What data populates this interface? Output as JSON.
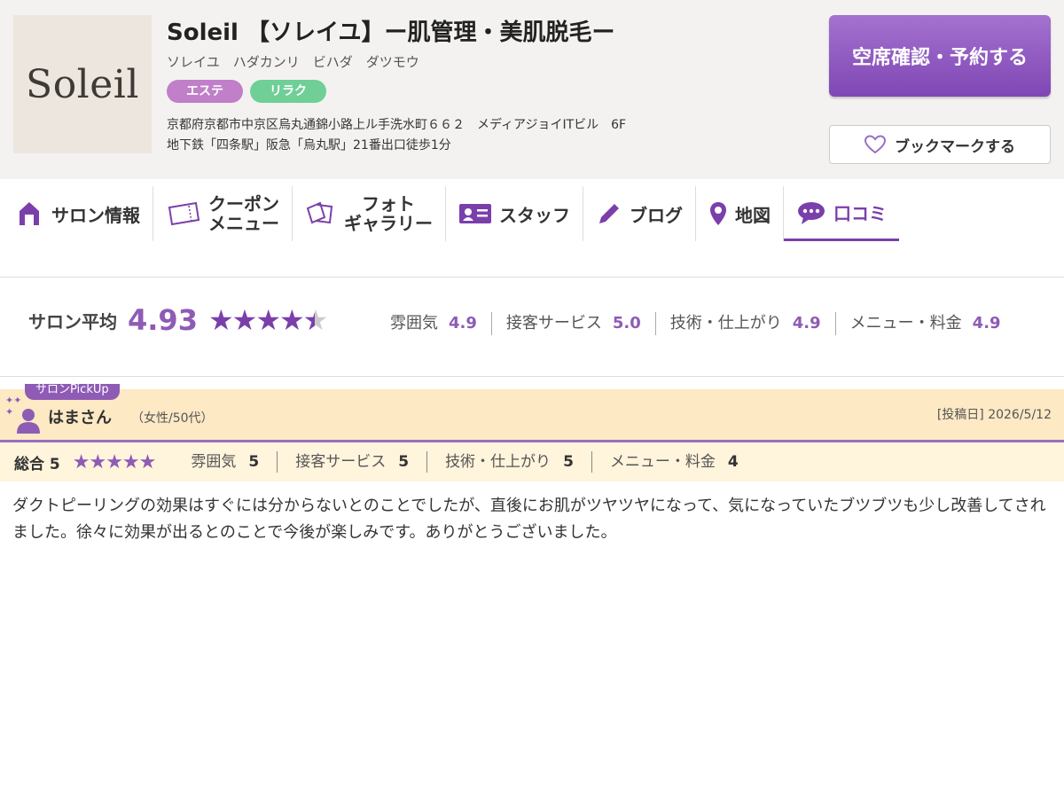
{
  "salon": {
    "logo_text": "Soleil",
    "title": "Soleil 【ソレイユ】ー肌管理・美肌脱毛ー",
    "kana": "ソレイユ　ハダカンリ　ビハダ　ダツモウ",
    "tags": [
      "エステ",
      "リラク"
    ],
    "address": "京都府京都市中京区烏丸通錦小路上ル手洗水町６６２　メディアジョイITビル　6F",
    "access": "地下鉄「四条駅」阪急「烏丸駅」21番出口徒歩1分"
  },
  "actions": {
    "reserve_label": "空席確認・予約する",
    "bookmark_label": "ブックマークする"
  },
  "nav": {
    "salon_info": "サロン情報",
    "coupon_line1": "クーポン",
    "coupon_line2": "メニュー",
    "photo_line1": "フォト",
    "photo_line2": "ギャラリー",
    "staff": "スタッフ",
    "blog": "ブログ",
    "map": "地図",
    "reviews": "口コミ"
  },
  "ratings": {
    "avg_label": "サロン平均",
    "avg_value": "4.93",
    "avg_stars": 4.93,
    "categories": [
      {
        "label": "雰囲気",
        "value": "4.9"
      },
      {
        "label": "接客サービス",
        "value": "5.0"
      },
      {
        "label": "技術・仕上がり",
        "value": "4.9"
      },
      {
        "label": "メニュー・料金",
        "value": "4.9"
      }
    ]
  },
  "review": {
    "pickup_label": "サロンPickUp",
    "user_name": "はまさん",
    "user_meta": "（女性/50代）",
    "post_date": "[投稿日] 2026/5/12",
    "total_label": "総合 5",
    "total_stars": 5,
    "categories": [
      {
        "label": "雰囲気",
        "value": "5"
      },
      {
        "label": "接客サービス",
        "value": "5"
      },
      {
        "label": "技術・仕上がり",
        "value": "5"
      },
      {
        "label": "メニュー・料金",
        "value": "4"
      }
    ],
    "body": "ダクトピーリングの効果はすぐには分からないとのことでしたが、直後にお肌がツヤツヤになって、気になっていたブツブツも少し改善してされました。徐々に効果が出るとのことで今後が楽しみです。ありがとうございました。"
  },
  "colors": {
    "accent": "#7b3fab",
    "review_bg": "#fde9c4"
  }
}
